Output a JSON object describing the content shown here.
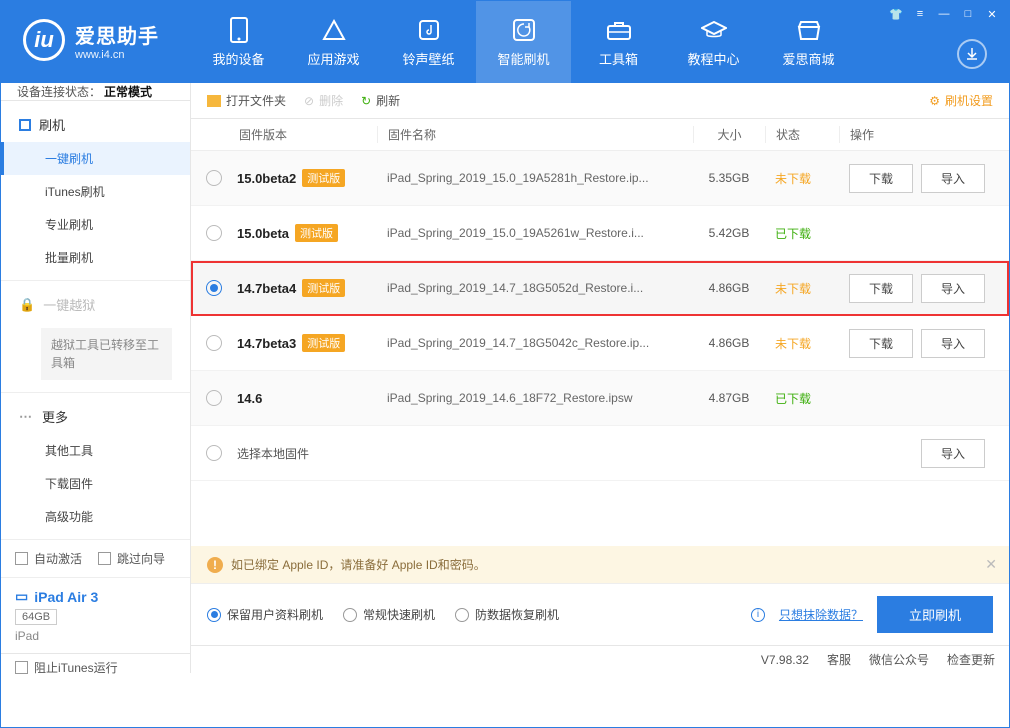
{
  "app": {
    "name_cn": "爱思助手",
    "name_en": "www.i4.cn"
  },
  "nav": {
    "my_device": "我的设备",
    "app_games": "应用游戏",
    "ringtone": "铃声壁纸",
    "smart_flash": "智能刷机",
    "toolbox": "工具箱",
    "tutorial": "教程中心",
    "store": "爱思商城"
  },
  "conn": {
    "label": "设备连接状态：",
    "value": "正常模式"
  },
  "side": {
    "flash": "刷机",
    "one_click": "一键刷机",
    "itunes": "iTunes刷机",
    "pro": "专业刷机",
    "batch": "批量刷机",
    "jailbreak": "一键越狱",
    "jb_note": "越狱工具已转移至工具箱",
    "more": "更多",
    "other_tools": "其他工具",
    "download_fw": "下载固件",
    "advanced": "高级功能"
  },
  "side_checks": {
    "auto_activate": "自动激活",
    "skip_guide": "跳过向导"
  },
  "device": {
    "name": "iPad Air 3",
    "capacity": "64GB",
    "model": "iPad"
  },
  "toolbar": {
    "open_folder": "打开文件夹",
    "delete": "删除",
    "refresh": "刷新",
    "settings": "刷机设置"
  },
  "headers": {
    "version": "固件版本",
    "name": "固件名称",
    "size": "大小",
    "status": "状态",
    "action": "操作"
  },
  "rows": [
    {
      "version": "15.0beta2",
      "beta": "测试版",
      "name": "iPad_Spring_2019_15.0_19A5281h_Restore.ip...",
      "size": "5.35GB",
      "status": "未下载",
      "status_kind": "nd",
      "download": "下载",
      "import": "导入",
      "selected": false,
      "show_dl": true,
      "show_imp": true
    },
    {
      "version": "15.0beta",
      "beta": "测试版",
      "name": "iPad_Spring_2019_15.0_19A5261w_Restore.i...",
      "size": "5.42GB",
      "status": "已下载",
      "status_kind": "ok",
      "selected": false,
      "show_dl": false,
      "show_imp": false
    },
    {
      "version": "14.7beta4",
      "beta": "测试版",
      "name": "iPad_Spring_2019_14.7_18G5052d_Restore.i...",
      "size": "4.86GB",
      "status": "未下载",
      "status_kind": "nd",
      "download": "下载",
      "import": "导入",
      "selected": true,
      "highlight": true,
      "show_dl": true,
      "show_imp": true
    },
    {
      "version": "14.7beta3",
      "beta": "测试版",
      "name": "iPad_Spring_2019_14.7_18G5042c_Restore.ip...",
      "size": "4.86GB",
      "status": "未下载",
      "status_kind": "nd",
      "download": "下载",
      "import": "导入",
      "selected": false,
      "show_dl": true,
      "show_imp": true
    },
    {
      "version": "14.6",
      "beta": "",
      "name": "iPad_Spring_2019_14.6_18F72_Restore.ipsw",
      "size": "4.87GB",
      "status": "已下载",
      "status_kind": "ok",
      "selected": false,
      "show_dl": false,
      "show_imp": false
    }
  ],
  "local_row": {
    "label": "选择本地固件",
    "import": "导入"
  },
  "warn": "如已绑定 Apple ID，请准备好 Apple ID和密码。",
  "options": {
    "keep_data": "保留用户资料刷机",
    "quick": "常规快速刷机",
    "anti_loss": "防数据恢复刷机",
    "erase_link": "只想抹除数据？",
    "flash_now": "立即刷机"
  },
  "status": {
    "block_itunes": "阻止iTunes运行",
    "version": "V7.98.32",
    "service": "客服",
    "wechat": "微信公众号",
    "update": "检查更新"
  }
}
